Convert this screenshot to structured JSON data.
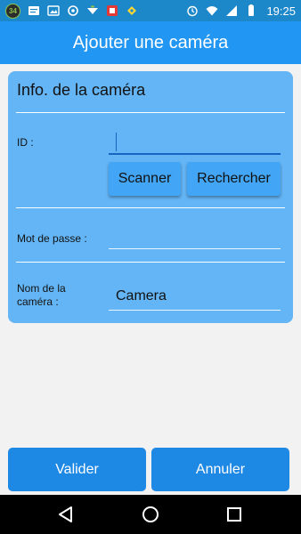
{
  "status_bar": {
    "notification_count": "34",
    "time": "19:25",
    "colors": {
      "background": "#1c87c9"
    }
  },
  "app_bar": {
    "title": "Ajouter une caméra",
    "colors": {
      "background": "#2196f3",
      "text": "#ffffff"
    }
  },
  "camera_info": {
    "title": "Info. de la caméra",
    "id_label": "ID :",
    "id_value": "",
    "scan_button": "Scanner",
    "search_button": "Rechercher",
    "password_label": "Mot de passe :",
    "password_value": "",
    "name_label_line1": "Nom de la",
    "name_label_line2": "caméra :",
    "name_value": "Camera",
    "colors": {
      "card": "#64b5f6",
      "button": "#42a5f5"
    }
  },
  "actions": {
    "validate": "Valider",
    "cancel": "Annuler",
    "colors": {
      "button": "#1e88e5"
    }
  },
  "icons": {
    "status_left": [
      "notification-count-icon",
      "message-icon",
      "image-icon",
      "sync-icon",
      "download-icon",
      "app-icon",
      "tag-icon"
    ],
    "status_right": [
      "alarm-icon",
      "wifi-icon",
      "signal-icon",
      "battery-icon"
    ],
    "nav": [
      "back-icon",
      "home-icon",
      "recents-icon"
    ]
  }
}
